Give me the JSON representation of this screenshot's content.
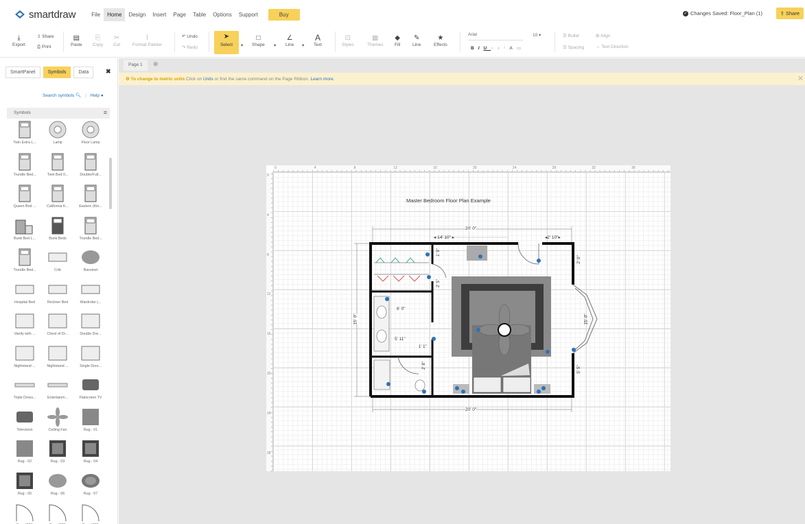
{
  "app": {
    "logo_text": "smartdraw"
  },
  "menu": [
    "File",
    "Home",
    "Design",
    "Insert",
    "Page",
    "Table",
    "Options",
    "Support"
  ],
  "menu_active": "Home",
  "buy_label": "Buy",
  "status": {
    "text": "Changes Saved: Floor_Plan (1)"
  },
  "share_label": "Share",
  "ribbon": {
    "export": "Export",
    "share": "Share",
    "print": "Print",
    "paste": "Paste",
    "copy": "Copy",
    "cut": "Cut",
    "format_painter": "Format Painter",
    "undo": "Undo",
    "redo": "Redo",
    "select": "Select",
    "shape": "Shape",
    "line": "Line",
    "text": "Text",
    "styles": "Styles",
    "themes": "Themes",
    "fill": "Fill",
    "line2": "Line",
    "effects": "Effects",
    "font": "Arial",
    "font_size": "10",
    "bullet": "Bullet",
    "align": "Align",
    "spacing": "Spacing",
    "text_direction": "Text Direction",
    "bold": "B",
    "italic": "I",
    "underline": "U"
  },
  "left_panel": {
    "tabs": [
      "SmartPanel",
      "Symbols",
      "Data"
    ],
    "active_tab": "Symbols",
    "search_link": "Search symbols",
    "help_link": "Help",
    "section_title": "Symbols",
    "symbols": [
      [
        "Twin Extra L...",
        "Lamp",
        "Floor Lamp"
      ],
      [
        "Trundle Bed...",
        "Twin Bed 0...",
        "Double/Full..."
      ],
      [
        "Queen Bed ...",
        "California K...",
        "Eastern (Kin..."
      ],
      [
        "Bunk Bed L...",
        "Bunk Beds",
        "Trundle Bed..."
      ],
      [
        "Trundle Bed...",
        "Crib",
        "Bassinet"
      ],
      [
        "Hospital Bed",
        "Recliner Bed",
        "Wardrobe (..."
      ],
      [
        "Vanity with ...",
        "Chest of Dr...",
        "Double Dre..."
      ],
      [
        "Nightstand ...",
        "Nightstand ...",
        "Single Dres..."
      ],
      [
        "Triple Dress...",
        "Entertainm...",
        "Flatscreen TV"
      ],
      [
        "Television",
        "Ceiling Fan",
        "Rug - 01"
      ],
      [
        "Rug - 02",
        "Rug - 03",
        "Rug - 04"
      ],
      [
        "Rug - 05",
        "Rug - 06",
        "Rug - 07"
      ],
      [
        "Door (30\")",
        "Door (30\")",
        "Door (30\")"
      ]
    ]
  },
  "canvas": {
    "page_tab": "Page 1",
    "notice_bold": "To change to metric units",
    "notice_text": " Click on ",
    "notice_units": "Units",
    "notice_text2": " or find the same command on the Page Ribbon. ",
    "notice_learn": "Learn more.",
    "ruler_top": [
      "0",
      "4",
      "8",
      "12",
      "16",
      "20",
      "24",
      "28",
      "32",
      "36"
    ],
    "ruler_left": [
      "0",
      "4",
      "8",
      "12",
      "16",
      "20",
      "24",
      "28"
    ]
  },
  "plan": {
    "title": "Master Bedroom Floor Plan Example",
    "dims": {
      "top_total": "20' 0\"",
      "top_left": "14' 10\"",
      "top_right": "2' 10\"",
      "bottom_total": "20' 0\"",
      "left_height": "15' 0\"",
      "right_window": "15' 0\"",
      "right_top": "2' 0\"",
      "right_bottom": "5' 5\"",
      "closet_h": "1' 9\"",
      "closet_h2": "2' 5\"",
      "bath_w": "6' 0\"",
      "bath_w2": "5' 11\"",
      "small": "1' 1\"",
      "wc_h": "2' 8\""
    }
  },
  "colors": {
    "accent": "#f7d15a",
    "link": "#2d72b8",
    "notice_bg": "#fbf1cf"
  }
}
